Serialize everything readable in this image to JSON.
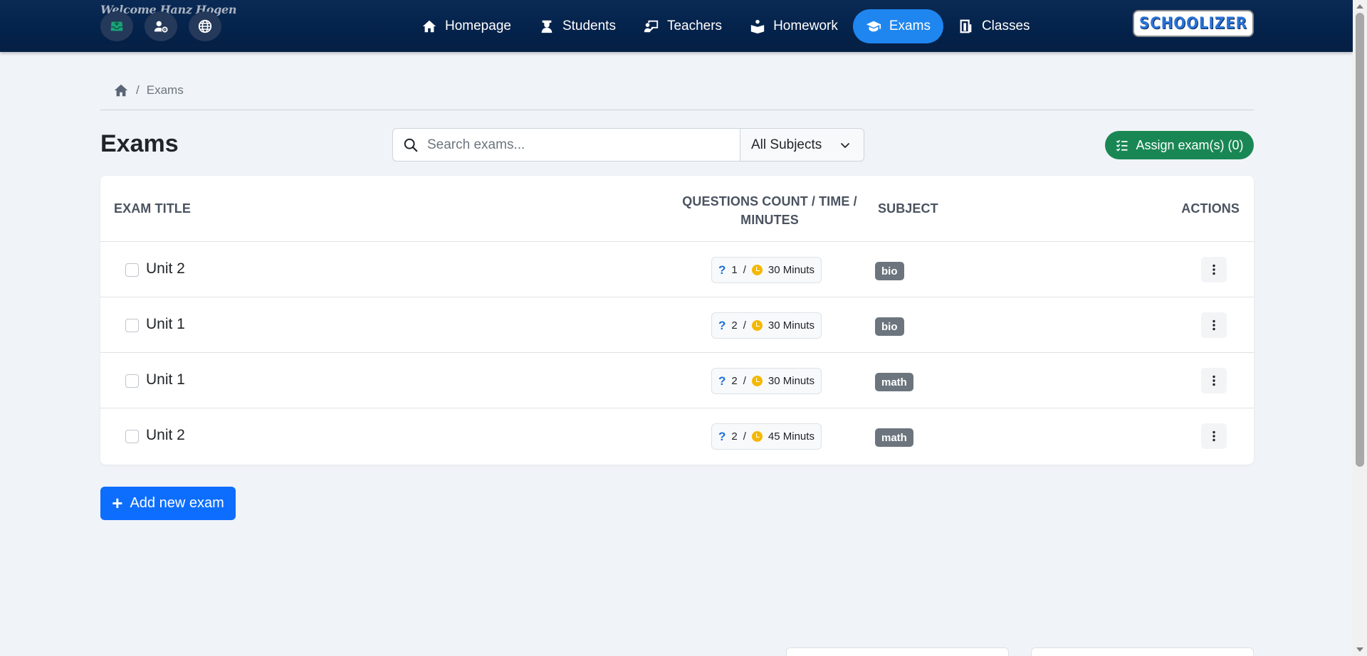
{
  "header": {
    "welcome": "Welcome Hanz Hogen",
    "logo_text": "SCHOOLIZER",
    "quick_icons": [
      "inbox-icon",
      "user-settings-icon",
      "globe-icon"
    ],
    "nav": [
      {
        "label": "Homepage",
        "icon": "home-icon",
        "active": false
      },
      {
        "label": "Students",
        "icon": "student-icon",
        "active": false
      },
      {
        "label": "Teachers",
        "icon": "teacher-icon",
        "active": false
      },
      {
        "label": "Homework",
        "icon": "homework-icon",
        "active": false
      },
      {
        "label": "Exams",
        "icon": "graduation-cap-icon",
        "active": true
      },
      {
        "label": "Classes",
        "icon": "classes-icon",
        "active": false
      }
    ]
  },
  "breadcrumb": {
    "home_icon": "home-icon",
    "separator": "/",
    "current": "Exams"
  },
  "page": {
    "title": "Exams",
    "search_placeholder": "Search exams...",
    "subject_filter": "All Subjects",
    "assign_button": "Assign exam(s) (0)",
    "add_button": "Add new exam"
  },
  "table": {
    "headers": {
      "title": "EXAM TITLE",
      "qcount_line1": "QUESTIONS COUNT / TIME /",
      "qcount_line2": "MINUTES",
      "subject": "SUBJECT",
      "actions": "ACTIONS"
    },
    "rows": [
      {
        "title": "Unit 2",
        "questions": "1",
        "time": "30 Minuts",
        "subject": "bio"
      },
      {
        "title": "Unit 1",
        "questions": "2",
        "time": "30 Minuts",
        "subject": "bio"
      },
      {
        "title": "Unit 1",
        "questions": "2",
        "time": "30 Minuts",
        "subject": "math"
      },
      {
        "title": "Unit 2",
        "questions": "2",
        "time": "45 Minuts",
        "subject": "math"
      }
    ],
    "q_icon": "?",
    "slash": "/"
  },
  "colors": {
    "nav_bg": "#04224a",
    "nav_active": "#1f86f0",
    "assign": "#198754",
    "add": "#0d6efd",
    "badge": "#6c757d",
    "clock": "#f5b800"
  }
}
